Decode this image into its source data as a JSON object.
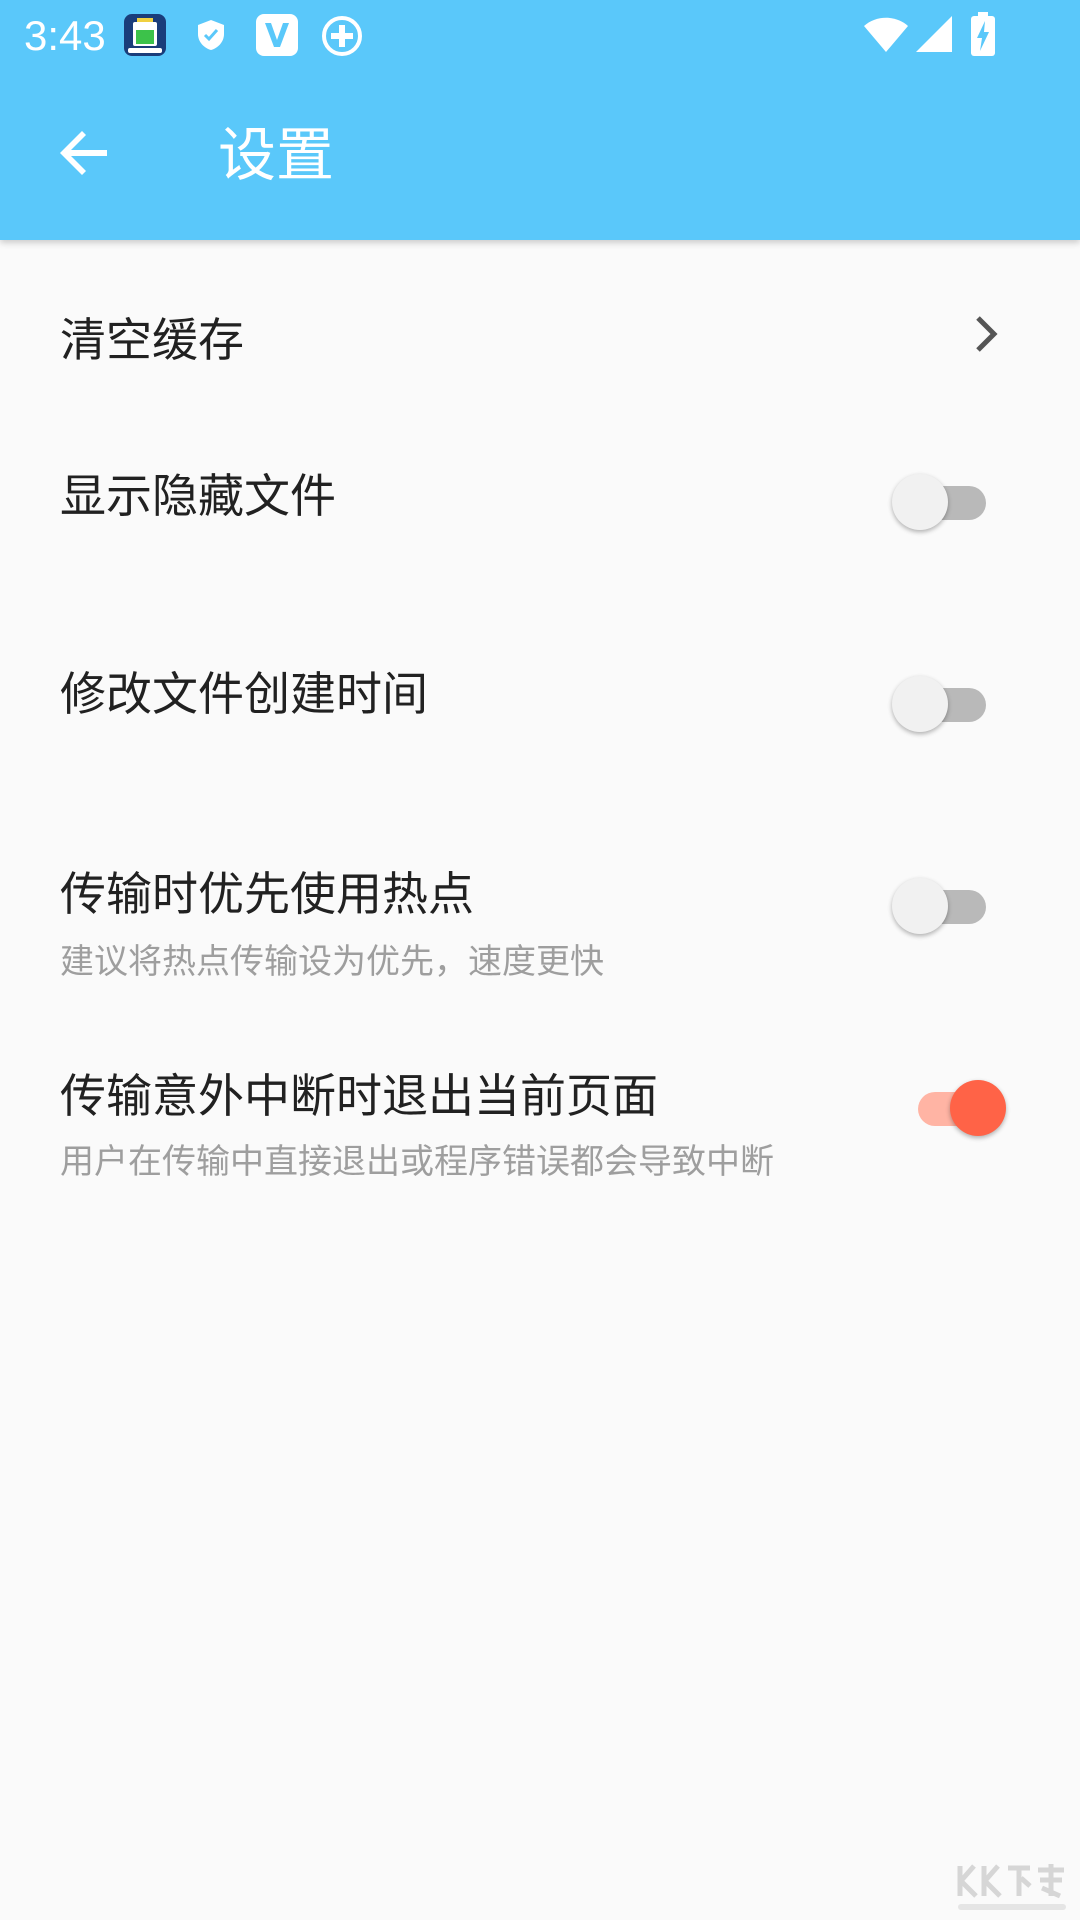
{
  "status_bar": {
    "time": "3:43",
    "icons": [
      "battery-app-icon",
      "shield-icon",
      "v-app-icon",
      "plus-circle-icon",
      "wifi-icon",
      "signal-icon",
      "battery-charging-icon"
    ]
  },
  "app_bar": {
    "back_icon": "arrow-back-icon",
    "title": "设置",
    "color": "#5ac8fa"
  },
  "settings": {
    "clear_cache": {
      "title": "清空缓存",
      "icon": "chevron-right-icon"
    },
    "show_hidden": {
      "title": "显示隐藏文件",
      "enabled": false
    },
    "modify_time": {
      "title": "修改文件创建时间",
      "enabled": false
    },
    "hotspot_priority": {
      "title": "传输时优先使用热点",
      "subtitle": "建议将热点传输设为优先，速度更快",
      "enabled": false
    },
    "exit_on_interrupt": {
      "title": "传输意外中断时退出当前页面",
      "subtitle": "用户在传输中直接退出或程序错误都会导致中断",
      "enabled": true
    }
  },
  "colors": {
    "accent": "#ff6347",
    "accent_track": "#ffb4a4",
    "switch_off_track": "#b9b9b9",
    "switch_off_thumb": "#f1f1f1",
    "subtitle": "#9e9e9e"
  },
  "watermark": {
    "logo": "KK下载",
    "url": "www.kkx.net"
  }
}
